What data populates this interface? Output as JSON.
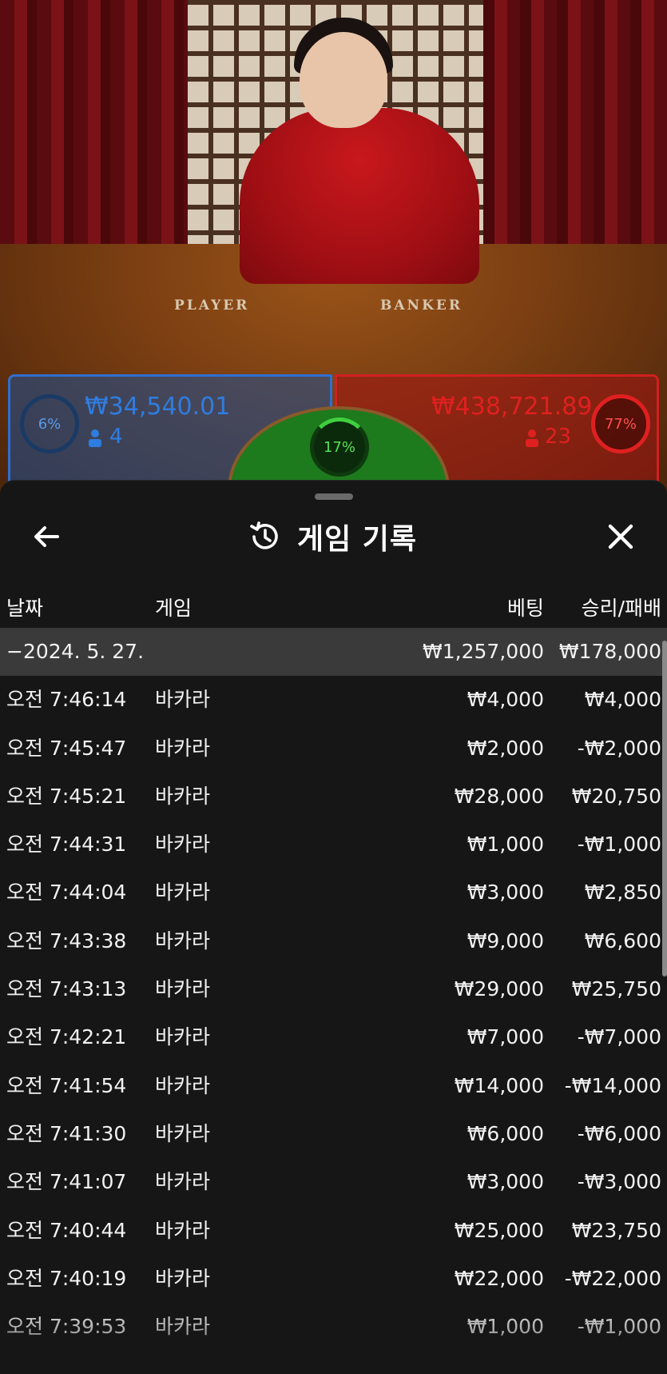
{
  "table": {
    "player_word": "PLAYER",
    "banker_word": "BANKER",
    "player": {
      "percent": "6%",
      "amount": "₩34,540.01",
      "count": "4"
    },
    "tie": {
      "percent": "17%"
    },
    "banker": {
      "percent": "77%",
      "amount": "₩438,721.89",
      "count": "23"
    }
  },
  "colors": {
    "player": "#2f6fd0",
    "banker": "#d02020",
    "tie": "#1d7a1d",
    "sheet_bg": "#161616",
    "date_row_bg": "#3a3a3a"
  },
  "sheet": {
    "title": "게임 기록",
    "icons": {
      "back": "arrow-left-icon",
      "history": "history-icon",
      "close": "close-icon"
    },
    "columns": {
      "date": "날짜",
      "game": "게임",
      "bet": "베팅",
      "win_loss": "승리/패배"
    },
    "date_group": {
      "label": "−2024. 5. 27.",
      "bet": "₩1,257,000",
      "win_loss": "₩178,000"
    },
    "rows": [
      {
        "time": "오전 7:46:14",
        "game": "바카라",
        "bet": "₩4,000",
        "win_loss": "₩4,000"
      },
      {
        "time": "오전 7:45:47",
        "game": "바카라",
        "bet": "₩2,000",
        "win_loss": "-₩2,000"
      },
      {
        "time": "오전 7:45:21",
        "game": "바카라",
        "bet": "₩28,000",
        "win_loss": "₩20,750"
      },
      {
        "time": "오전 7:44:31",
        "game": "바카라",
        "bet": "₩1,000",
        "win_loss": "-₩1,000"
      },
      {
        "time": "오전 7:44:04",
        "game": "바카라",
        "bet": "₩3,000",
        "win_loss": "₩2,850"
      },
      {
        "time": "오전 7:43:38",
        "game": "바카라",
        "bet": "₩9,000",
        "win_loss": "₩6,600"
      },
      {
        "time": "오전 7:43:13",
        "game": "바카라",
        "bet": "₩29,000",
        "win_loss": "₩25,750"
      },
      {
        "time": "오전 7:42:21",
        "game": "바카라",
        "bet": "₩7,000",
        "win_loss": "-₩7,000"
      },
      {
        "time": "오전 7:41:54",
        "game": "바카라",
        "bet": "₩14,000",
        "win_loss": "-₩14,000"
      },
      {
        "time": "오전 7:41:30",
        "game": "바카라",
        "bet": "₩6,000",
        "win_loss": "-₩6,000"
      },
      {
        "time": "오전 7:41:07",
        "game": "바카라",
        "bet": "₩3,000",
        "win_loss": "-₩3,000"
      },
      {
        "time": "오전 7:40:44",
        "game": "바카라",
        "bet": "₩25,000",
        "win_loss": "₩23,750"
      },
      {
        "time": "오전 7:40:19",
        "game": "바카라",
        "bet": "₩22,000",
        "win_loss": "-₩22,000"
      },
      {
        "time": "오전 7:39:53",
        "game": "바카라",
        "bet": "₩1,000",
        "win_loss": "-₩1,000"
      }
    ]
  }
}
